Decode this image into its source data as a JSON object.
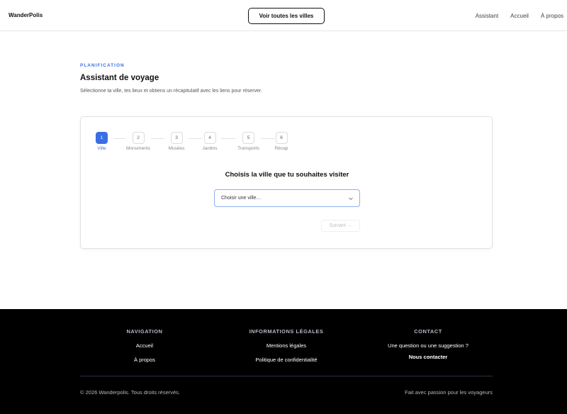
{
  "header": {
    "brand": "WanderPolis",
    "cta_label": "Voir toutes les villes",
    "nav": [
      "Assistant",
      "Accueil",
      "À propos"
    ]
  },
  "intro": {
    "eyebrow": "PLANIFICATION",
    "title": "Assistant de voyage",
    "subtitle": "Sélectionne ta ville, tes lieux et obtiens un récapitulatif avec les liens pour réserver."
  },
  "wizard": {
    "steps": [
      {
        "num": "1",
        "label": "Ville",
        "active": true
      },
      {
        "num": "2",
        "label": "Monuments",
        "active": false
      },
      {
        "num": "3",
        "label": "Musées",
        "active": false
      },
      {
        "num": "4",
        "label": "Jardins",
        "active": false
      },
      {
        "num": "5",
        "label": "Transports",
        "active": false
      },
      {
        "num": "6",
        "label": "Récap",
        "active": false
      }
    ],
    "question": "Choisis la ville que tu souhaites visiter",
    "select_value": "Choisir une ville…",
    "next_label": "Suivant →"
  },
  "footer": {
    "nav_heading": "NAVIGATION",
    "nav_links": [
      "Accueil",
      "À propos"
    ],
    "legal_heading": "INFORMATIONS LÉGALES",
    "legal_links": [
      "Mentions légales",
      "Politique de confidentialité"
    ],
    "contact_heading": "CONTACT",
    "contact_text": "Une question ou une suggestion ?",
    "contact_link": "Nous contacter",
    "copyright": "© 2026 Wanderpolis. Tous droits réservés.",
    "tagline": "Fait avec passion pour les voyageurs"
  },
  "colors": {
    "accent": "#3b6ee6",
    "footer_bg": "#000000"
  }
}
